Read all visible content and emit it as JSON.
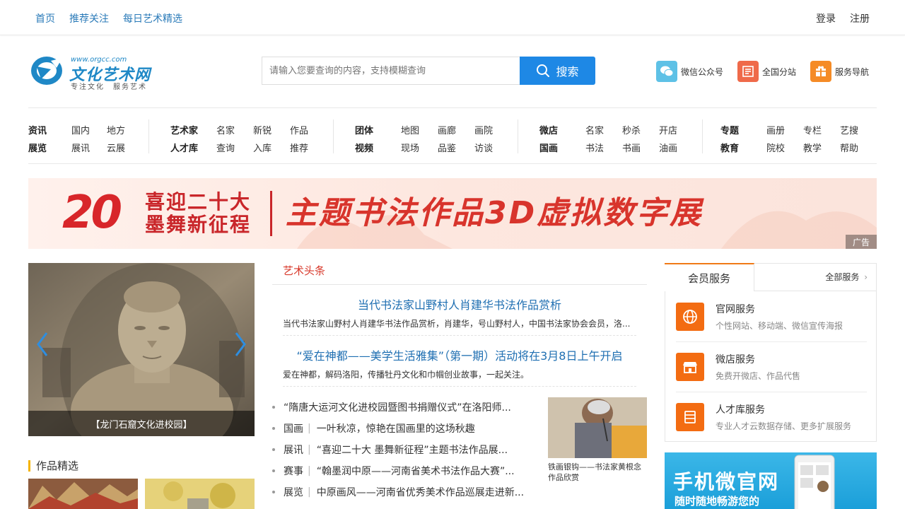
{
  "topbar": {
    "nav": [
      "首页",
      "推荐关注",
      "每日艺术精选"
    ],
    "login": "登录",
    "register": "注册"
  },
  "logo": {
    "url_text": "www.orgcc.com",
    "name": "文化艺术网",
    "slogan": "专注文化　服务艺术"
  },
  "search": {
    "placeholder": "请输入您要查询的内容，支持模糊查询",
    "button": "搜索"
  },
  "service_links": [
    {
      "label": "微信公众号",
      "icon": "wechat-icon",
      "color": "#5ec1e6"
    },
    {
      "label": "全国分站",
      "icon": "list-icon",
      "color": "#ef6a4a"
    },
    {
      "label": "服务导航",
      "icon": "gift-icon",
      "color": "#f58b26"
    }
  ],
  "nav_groups": [
    {
      "rows": [
        [
          "资讯",
          "国内",
          "地方"
        ],
        [
          "展览",
          "展讯",
          "云展"
        ]
      ]
    },
    {
      "rows": [
        [
          "艺术家",
          "名家",
          "新锐",
          "作品"
        ],
        [
          "人才库",
          "查询",
          "入库",
          "推荐"
        ]
      ]
    },
    {
      "rows": [
        [
          "团体",
          "地图",
          "画廊",
          "画院"
        ],
        [
          "视频",
          "现场",
          "品鉴",
          "访谈"
        ]
      ]
    },
    {
      "rows": [
        [
          "微店",
          "名家",
          "秒杀",
          "开店"
        ],
        [
          "国画",
          "书法",
          "书画",
          "油画"
        ]
      ]
    },
    {
      "rows": [
        [
          "专题",
          "画册",
          "专栏",
          "艺搜"
        ],
        [
          "教育",
          "院校",
          "教学",
          "帮助"
        ]
      ]
    }
  ],
  "banner": {
    "number": "20",
    "line1": "喜迎二十大",
    "line2": "墨舞新征程",
    "headline": "主题书法作品3D虚拟数字展",
    "ad_label": "广告"
  },
  "carousel": {
    "caption": "【龙门石窟文化进校园】"
  },
  "works_section": {
    "title": "作品精选"
  },
  "headlines": {
    "title": "艺术头条",
    "top": [
      {
        "headline": "当代书法家山野村人肖建华书法作品赏析",
        "summary": "当代书法家山野村人肖建华书法作品赏析，肖建华，号山野村人，中国书法家协会会员，洛..."
      },
      {
        "headline": "“爱在神都——美学生活雅集”（第一期）活动将在3月8日上午开启",
        "summary": "爱在神都，解码洛阳，传播牡丹文化和巾帼创业故事，一起关注。"
      }
    ],
    "list": [
      {
        "cat": "",
        "text": "“隋唐大运河文化进校园暨图书捐赠仪式”在洛阳师..."
      },
      {
        "cat": "国画",
        "text": "一叶秋凉，惊艳在国画里的这场秋趣"
      },
      {
        "cat": "展讯",
        "text": "“喜迎二十大 墨舞新征程”主题书法作品展..."
      },
      {
        "cat": "赛事",
        "text": "“翰墨润中原——河南省美术书法作品大赛”..."
      },
      {
        "cat": "展览",
        "text": "中原画风——河南省优秀美术作品巡展走进新..."
      }
    ],
    "sep": "|",
    "photo_caption": "铁画银钩——书法家黄根念作品欣赏"
  },
  "member": {
    "tab": "会员服务",
    "all_label": "全部服务",
    "services": [
      {
        "title": "官网服务",
        "desc": "个性网站、移动端、微信宣传海报",
        "icon": "globe-icon"
      },
      {
        "title": "微店服务",
        "desc": "免费开微店、作品代售",
        "icon": "store-icon"
      },
      {
        "title": "人才库服务",
        "desc": "专业人才云数据存储、更多扩展服务",
        "icon": "database-icon"
      }
    ]
  },
  "mobile_ad": {
    "title": "手机微官网",
    "subtitle": "随时随地畅游您的"
  },
  "colors": {
    "link_blue": "#2b7bb9",
    "search_blue": "#1e88e5",
    "headline_red": "#d83a2c",
    "service_orange": "#f36c12"
  }
}
